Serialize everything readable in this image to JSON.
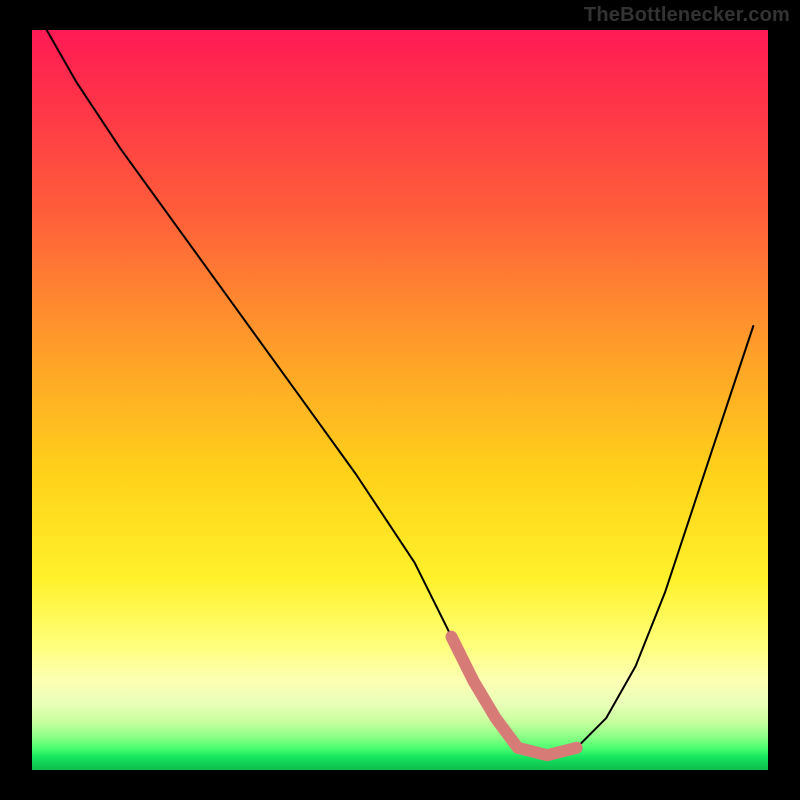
{
  "watermark": "TheBottlenecker.com",
  "chart_data": {
    "type": "line",
    "title": "",
    "xlabel": "",
    "ylabel": "",
    "xlim": [
      0,
      100
    ],
    "ylim": [
      0,
      100
    ],
    "series": [
      {
        "name": "bottleneck-curve",
        "x": [
          2,
          6,
          12,
          20,
          28,
          36,
          44,
          52,
          57,
          60,
          63,
          66,
          70,
          74,
          78,
          82,
          86,
          90,
          94,
          98
        ],
        "y": [
          100,
          93,
          84,
          73,
          62,
          51,
          40,
          28,
          18,
          12,
          7,
          3,
          2,
          3,
          7,
          14,
          24,
          36,
          48,
          60
        ]
      }
    ],
    "target_band": {
      "name": "optimal-range-highlight",
      "x": [
        57,
        60,
        63,
        66,
        70,
        74
      ],
      "y": [
        18,
        12,
        7,
        3,
        2,
        3
      ]
    },
    "background_gradient_stops": [
      {
        "pos": 0,
        "color": "#ff1a55"
      },
      {
        "pos": 0.42,
        "color": "#ff9a2a"
      },
      {
        "pos": 0.74,
        "color": "#fff12a"
      },
      {
        "pos": 0.95,
        "color": "#8dff86"
      },
      {
        "pos": 1.0,
        "color": "#0fbd4e"
      }
    ]
  }
}
